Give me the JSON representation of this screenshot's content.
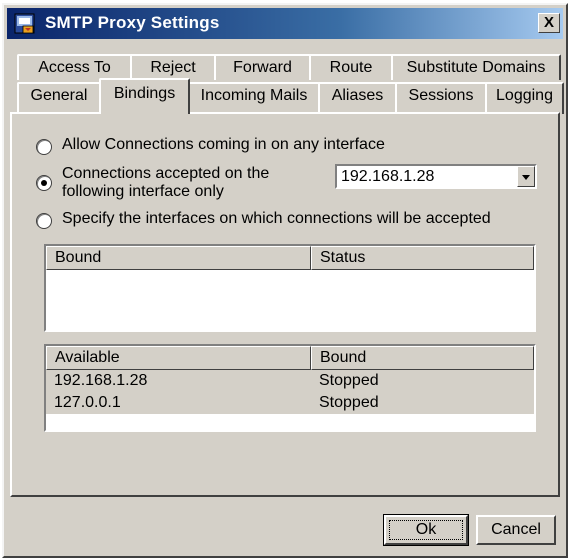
{
  "window": {
    "title": "SMTP Proxy Settings",
    "close_label": "X"
  },
  "tabs": {
    "row_top": [
      "Access To",
      "Reject",
      "Forward",
      "Route",
      "Substitute Domains"
    ],
    "row_bottom": [
      "General",
      "Bindings",
      "Incoming Mails",
      "Aliases",
      "Sessions",
      "Logging"
    ],
    "active": "Bindings"
  },
  "bindings": {
    "option_any": "Allow Connections coming in on any interface",
    "option_specific_line1": "Connections accepted on the",
    "option_specific_line2": "following interface only",
    "option_specify": "Specify the interfaces on which connections will be accepted",
    "selected_option": "option_specific",
    "interface_value": "192.168.1.28",
    "bound_table": {
      "columns": [
        "Bound",
        "Status"
      ],
      "rows": []
    },
    "available_table": {
      "columns": [
        "Available",
        "Bound"
      ],
      "rows": [
        [
          "192.168.1.28",
          "Stopped"
        ],
        [
          "127.0.0.1",
          "Stopped"
        ]
      ]
    }
  },
  "buttons": {
    "ok": "Ok",
    "cancel": "Cancel"
  }
}
